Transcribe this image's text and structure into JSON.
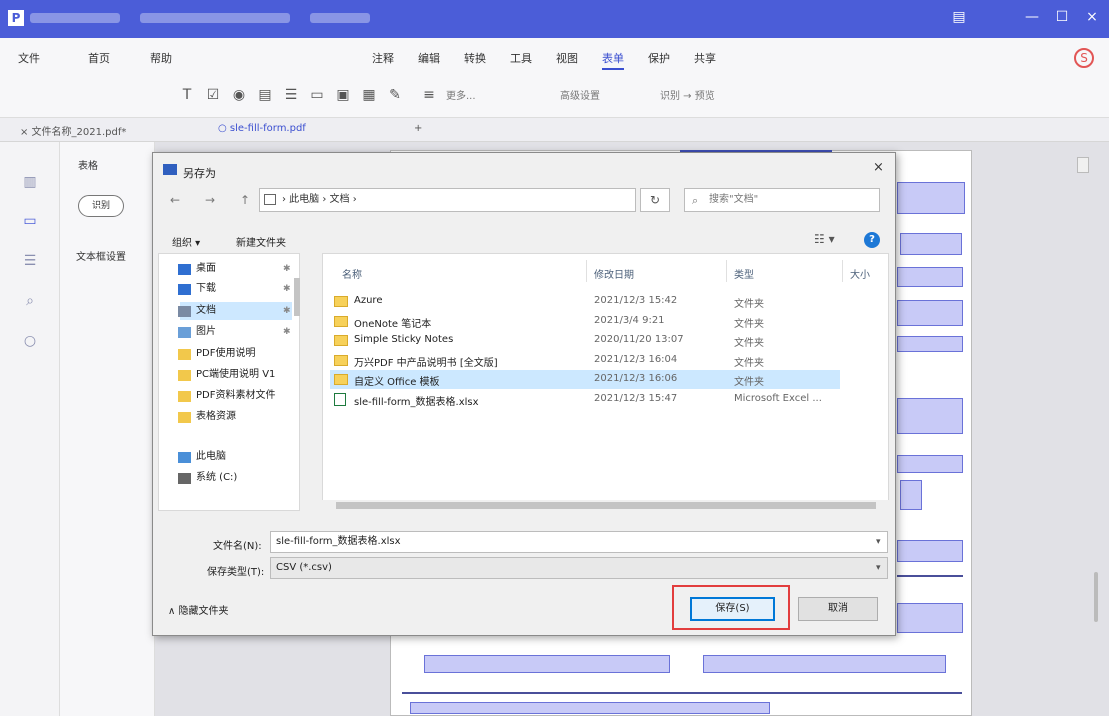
{
  "window": {
    "title": "",
    "minimize": "—",
    "maximize": "☐",
    "close": "×"
  },
  "menu": {
    "items": [
      {
        "label": "文件"
      },
      {
        "label": "首页"
      },
      {
        "label": "帮助"
      },
      {
        "label": "注释"
      },
      {
        "label": "编辑"
      },
      {
        "label": "转换"
      },
      {
        "label": "工具"
      },
      {
        "label": "视图"
      },
      {
        "label": "表单"
      },
      {
        "label": "保护"
      },
      {
        "label": "共享"
      }
    ],
    "active_index": 8
  },
  "toolbar": {
    "text_items": [
      "更多...",
      "高级设置",
      "识别 → 预览"
    ]
  },
  "tabs": [
    {
      "label": "× 文件名称_2021.pdf*"
    },
    {
      "label": "○ sle-fill-form.pdf"
    },
    {
      "label": "+"
    }
  ],
  "side_panel": {
    "title": "表格",
    "button": "识别",
    "text": "文本框设置"
  },
  "dialog": {
    "title": "另存为",
    "close": "×",
    "nav": {
      "back": "←",
      "forward": "→",
      "up": "↑"
    },
    "address": "› 此电脑 › 文档 ›",
    "refresh": "↻",
    "search_placeholder": "搜索\"文档\"",
    "organize": "组织 ▾",
    "new_folder": "新建文件夹",
    "view_toggle": "☷ ▾",
    "help": "?",
    "nav_items": [
      {
        "label": "桌面",
        "color": "#2f6fd1"
      },
      {
        "label": "下载",
        "color": "#2f6fd1"
      },
      {
        "label": "文档",
        "color": "#7a8aa3",
        "selected": true
      },
      {
        "label": "图片",
        "color": "#6a9fd8"
      },
      {
        "label": "PDF使用说明",
        "color": "#f2c84b"
      },
      {
        "label": "PC端使用说明 V1",
        "color": "#f2c84b"
      },
      {
        "label": "PDF资料素材文件",
        "color": "#f2c84b"
      },
      {
        "label": "表格资源",
        "color": "#f2c84b"
      },
      {
        "label": "此电脑",
        "color": "#4a8fd8"
      },
      {
        "label": "系统 (C:)",
        "color": "#666"
      }
    ],
    "columns": [
      "名称",
      "修改日期",
      "类型",
      "大小"
    ],
    "files": [
      {
        "name": "Azure",
        "date": "2021/12/3 15:42",
        "type": "文件夹",
        "kind": "folder"
      },
      {
        "name": "OneNote 笔记本",
        "date": "2021/3/4 9:21",
        "type": "文件夹",
        "kind": "folder"
      },
      {
        "name": "Simple Sticky Notes",
        "date": "2020/11/20 13:07",
        "type": "文件夹",
        "kind": "folder"
      },
      {
        "name": "万兴PDF 中产品说明书 [全文版]",
        "date": "2021/12/3 16:04",
        "type": "文件夹",
        "kind": "folder"
      },
      {
        "name": "自定义 Office 模板",
        "date": "2021/12/3 16:06",
        "type": "文件夹",
        "kind": "folder",
        "selected": true
      },
      {
        "name": "sle-fill-form_数据表格.xlsx",
        "date": "2021/12/3 15:47",
        "type": "Microsoft Excel ...",
        "kind": "xlsx"
      }
    ],
    "filename_label": "文件名(N):",
    "filename": "sle-fill-form_数据表格.xlsx",
    "filetype_label": "保存类型(T):",
    "filetype": "CSV (*.csv)",
    "hide_folders": "∧ 隐藏文件夹",
    "save": "保存(S)",
    "cancel": "取消"
  },
  "colors": {
    "brand": "#4b5dd8",
    "save_highlight": "#e23d3d"
  }
}
